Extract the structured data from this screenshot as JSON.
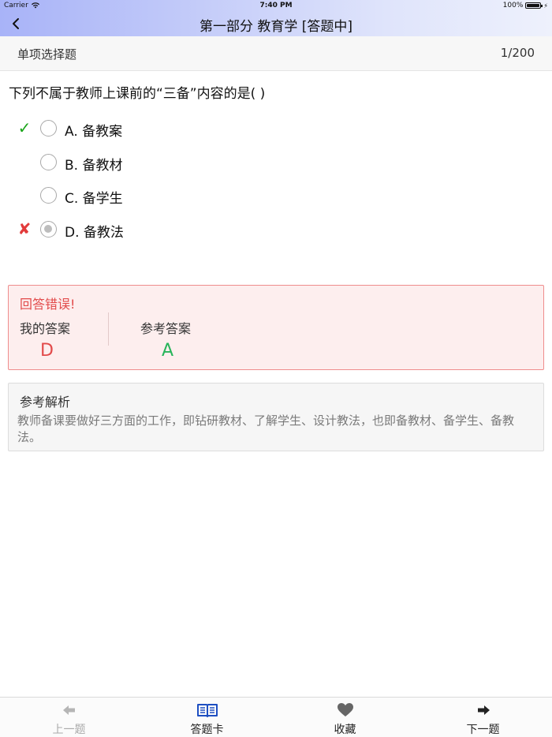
{
  "status_bar": {
    "carrier": "Carrier",
    "time": "7:40 PM",
    "battery": "100%"
  },
  "nav": {
    "title": "第一部分 教育学 [答题中]",
    "back_icon": "chevron-left-icon"
  },
  "subheader": {
    "question_type": "单项选择题",
    "progress": "1/200"
  },
  "question": {
    "text": "下列不属于教师上课前的“三备”内容的是(    )"
  },
  "options": [
    {
      "label": "A. 备教案",
      "selected": false,
      "result": "correct"
    },
    {
      "label": "B. 备教材",
      "selected": false,
      "result": ""
    },
    {
      "label": "C. 备学生",
      "selected": false,
      "result": ""
    },
    {
      "label": "D. 备教法",
      "selected": true,
      "result": "wrong"
    }
  ],
  "marks": {
    "correct": "✓",
    "wrong": "✘"
  },
  "result": {
    "headline": "回答错误!",
    "my_answer_label": "我的答案",
    "my_answer": "D",
    "reference_label": "参考答案",
    "reference_answer": "A"
  },
  "analysis": {
    "title": "参考解析",
    "text": "教师备课要做好三方面的工作，即钻研教材、了解学生、设计教法，也即备教材、备学生、备教法。"
  },
  "tabbar": [
    {
      "label": "上一题",
      "icon": "arrow-left-icon",
      "disabled": true
    },
    {
      "label": "答题卡",
      "icon": "book-icon",
      "disabled": false
    },
    {
      "label": "收藏",
      "icon": "heart-icon",
      "disabled": false
    },
    {
      "label": "下一题",
      "icon": "arrow-right-icon",
      "disabled": false
    }
  ],
  "colors": {
    "correct": "#1aa51a",
    "wrong": "#e23b3b",
    "reference": "#27b45a",
    "accent": "#1e4fc2"
  }
}
